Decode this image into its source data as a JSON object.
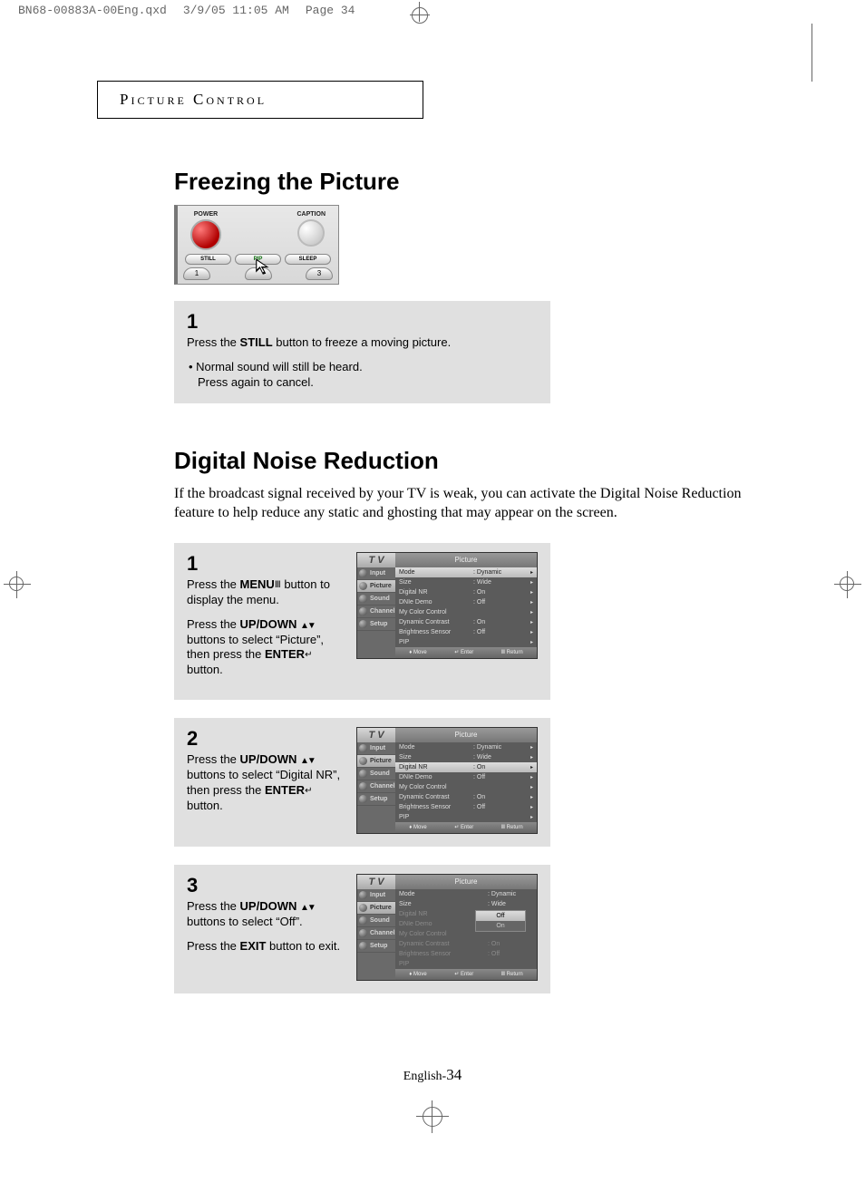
{
  "print_header": {
    "filename": "BN68-00883A-00Eng.qxd",
    "date": "3/9/05 11:05 AM",
    "page": "Page 34"
  },
  "section_tab": "Picture Control",
  "h_freezing": "Freezing the Picture",
  "remote": {
    "power": "POWER",
    "caption": "CAPTION",
    "still": "STILL",
    "pip": "PIP",
    "sleep": "SLEEP",
    "b1": "1",
    "b3": "3"
  },
  "step_freeze": {
    "num": "1",
    "l1a": "Press the ",
    "l1b": "STILL",
    "l1c": " button to freeze a moving picture.",
    "l2": "• Normal sound will still be heard.",
    "l3": "Press again to cancel."
  },
  "h_dnr": "Digital Noise Reduction",
  "intro_dnr": "If the broadcast signal received by your TV is weak, you can activate the Digital Noise Reduction feature to help reduce any static and ghosting that may appear on the screen.",
  "dnr1": {
    "num": "1",
    "p1a": "Press the ",
    "p1b": "MENU",
    "p1icon": "Ⅲ",
    "p1c": " button to display the menu.",
    "p2a": "Press the ",
    "p2b": "UP/DOWN",
    "p2icon": "▲▼",
    "p2c": " buttons to select “Picture”, then press the ",
    "p2d": "ENTER",
    "p2eicon": "↵",
    "p2e": " button."
  },
  "dnr2": {
    "num": "2",
    "p1a": "Press the ",
    "p1b": "UP/DOWN",
    "p1icon": "▲▼",
    "p1c": " buttons to select “Digital NR”, then press the ",
    "p1d": "ENTER",
    "p1eicon": "↵",
    "p1e": " button."
  },
  "dnr3": {
    "num": "3",
    "p1a": "Press the ",
    "p1b": "UP/DOWN",
    "p1icon": "▲▼",
    "p1c": " buttons to select “Off”.",
    "p2a": "Press the ",
    "p2b": "EXIT",
    "p2c": " button to exit."
  },
  "tv": {
    "tv": "T V",
    "title": "Picture",
    "side": [
      "Input",
      "Picture",
      "Sound",
      "Channel",
      "Setup"
    ],
    "rows": [
      {
        "k": "Mode",
        "v": ": Dynamic"
      },
      {
        "k": "Size",
        "v": ": Wide"
      },
      {
        "k": "Digital NR",
        "v": ": On"
      },
      {
        "k": "DNIe Demo",
        "v": ": Off"
      },
      {
        "k": "My Color Control",
        "v": ""
      },
      {
        "k": "Dynamic Contrast",
        "v": ": On"
      },
      {
        "k": "Brightness Sensor",
        "v": ": Off"
      },
      {
        "k": "PIP",
        "v": ""
      }
    ],
    "footer": {
      "move": "Move",
      "enter": "Enter",
      "return": "Return"
    },
    "popup": {
      "off": "Off",
      "on": "On"
    }
  },
  "footer": {
    "lang": "English-",
    "num": "34"
  }
}
